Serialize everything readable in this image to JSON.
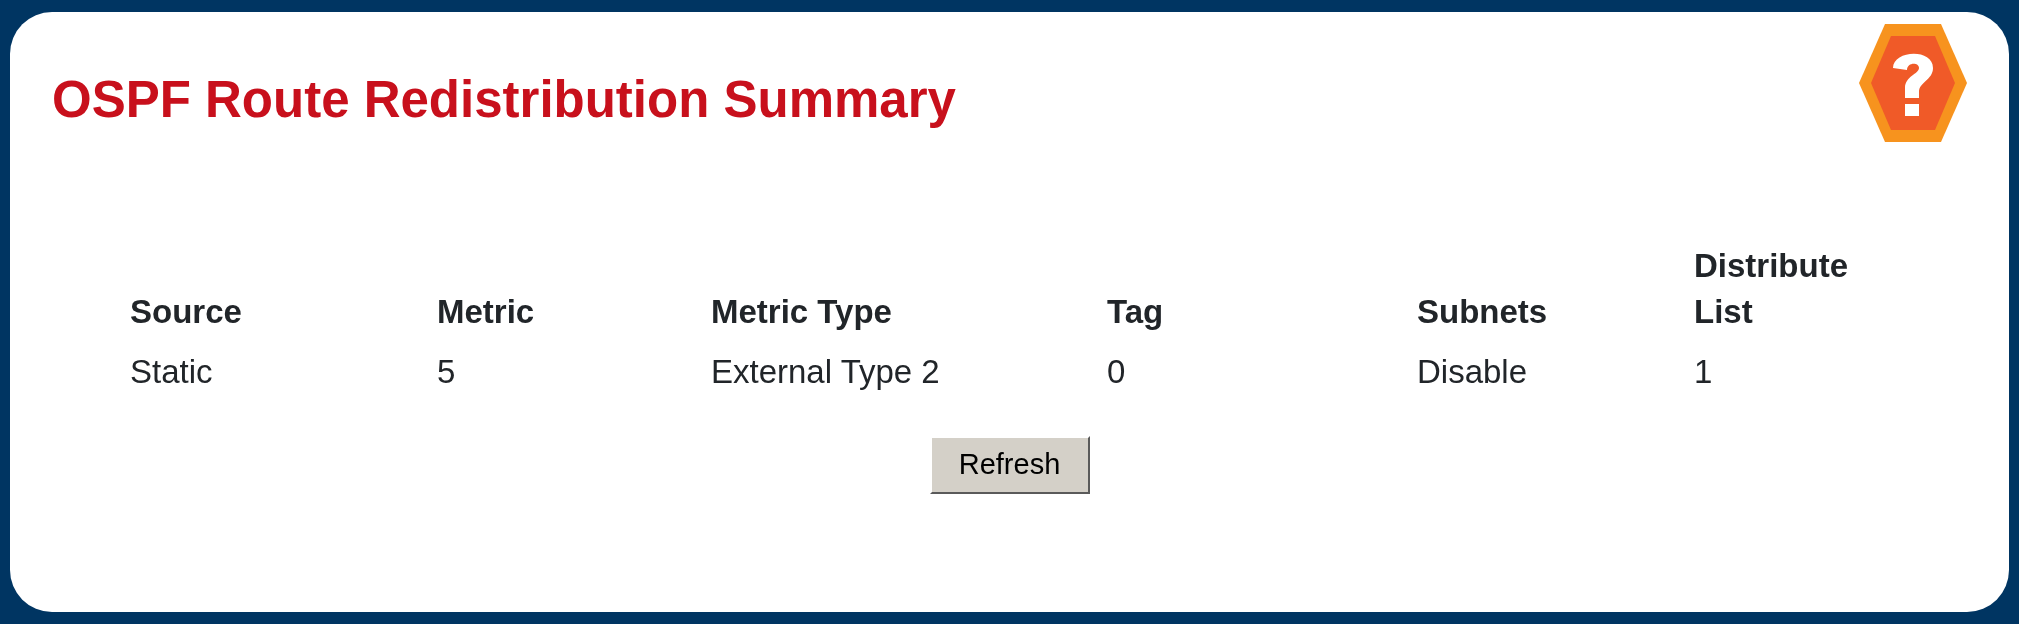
{
  "title": "OSPF Route Redistribution Summary",
  "table": {
    "columns": [
      "Source",
      "Metric",
      "Metric Type",
      "Tag",
      "Subnets",
      "Distribute List"
    ],
    "rows": [
      [
        "Static",
        "5",
        "External Type 2",
        "0",
        "Disable",
        "1"
      ]
    ]
  },
  "buttons": [
    "Refresh"
  ]
}
